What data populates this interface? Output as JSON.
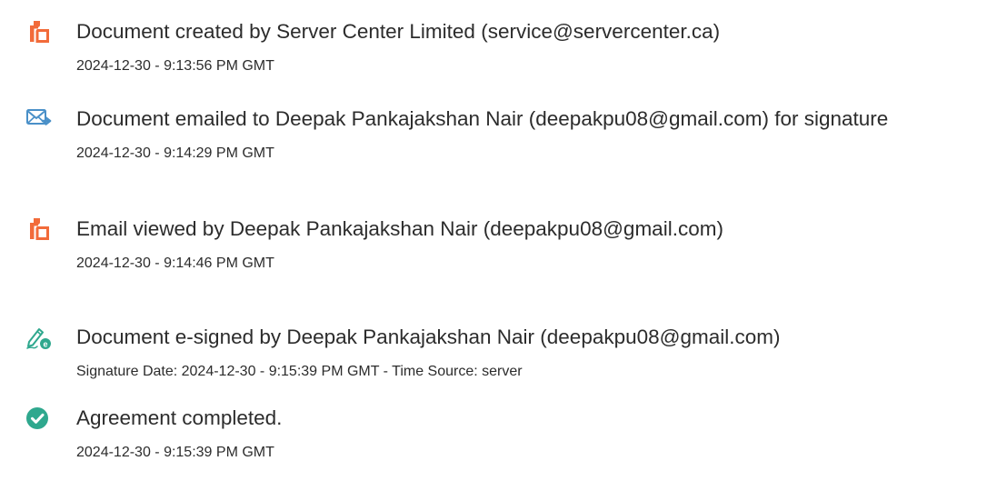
{
  "events": [
    {
      "icon": "document-created-icon",
      "title": "Document created by Server Center Limited (service@servercenter.ca)",
      "detail": "2024-12-30 - 9:13:56 PM GMT"
    },
    {
      "icon": "email-sent-icon",
      "title": "Document emailed to Deepak Pankajakshan Nair (deepakpu08@gmail.com) for signature",
      "detail": "2024-12-30 - 9:14:29 PM GMT"
    },
    {
      "icon": "email-viewed-icon",
      "title": "Email viewed by Deepak Pankajakshan Nair (deepakpu08@gmail.com)",
      "detail": "2024-12-30 - 9:14:46 PM GMT"
    },
    {
      "icon": "e-signed-pen-icon",
      "title": "Document e-signed by Deepak Pankajakshan Nair (deepakpu08@gmail.com)",
      "detail": "Signature Date: 2024-12-30 - 9:15:39 PM GMT - Time Source: server"
    },
    {
      "icon": "agreement-completed-check-icon",
      "title": "Agreement completed.",
      "detail": "2024-12-30 - 9:15:39 PM GMT"
    }
  ],
  "colors": {
    "document_icon": "#f26b3a",
    "email_icon": "#4a90c8",
    "signed_icon": "#2fa88e",
    "completed_icon": "#2fa88e",
    "text": "#2c2c2c"
  }
}
